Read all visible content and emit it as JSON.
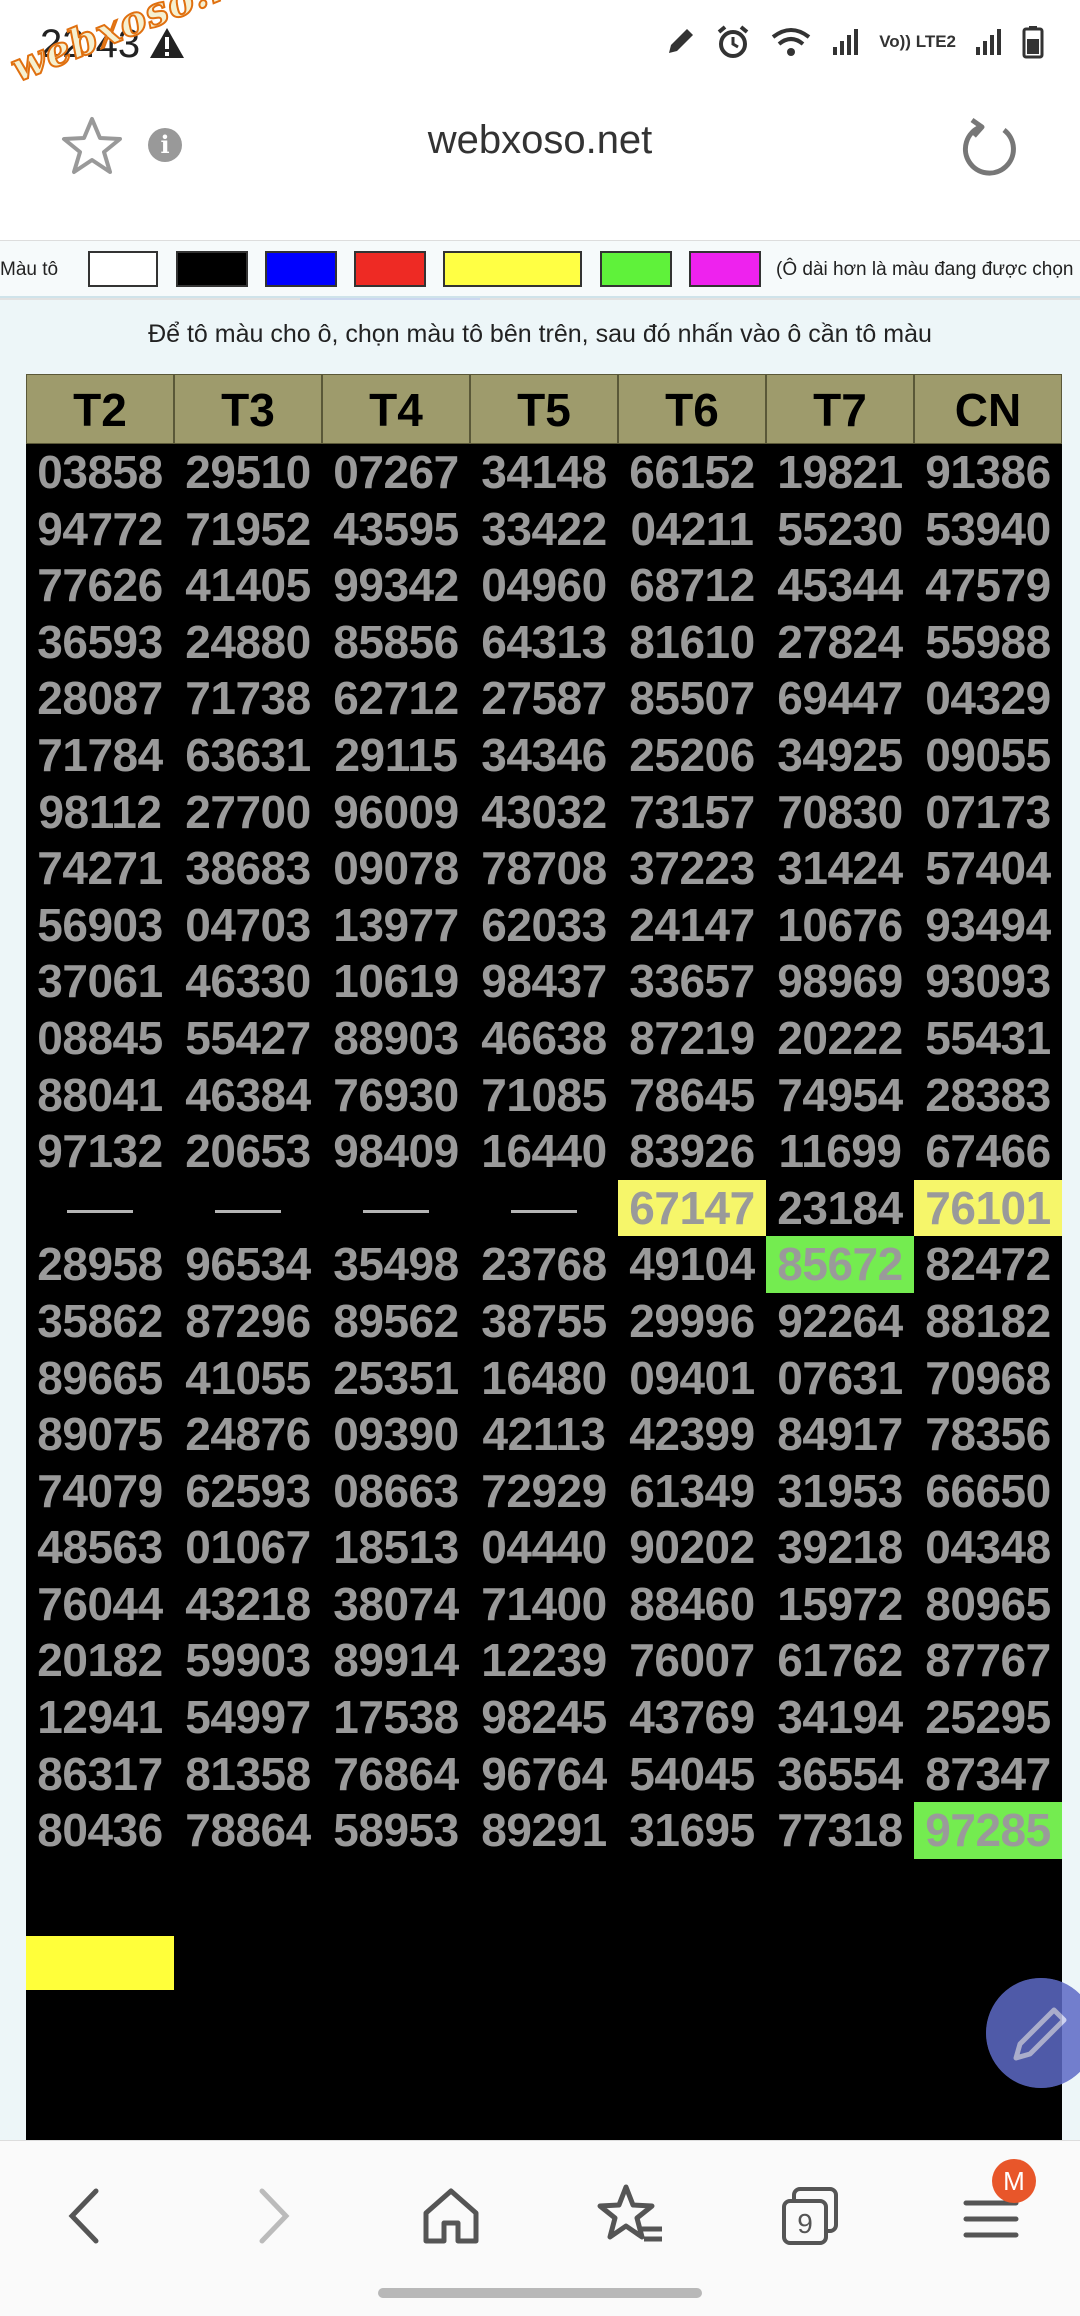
{
  "status": {
    "time": "22:43",
    "watermark": "webxoso.net",
    "network": "Vo)) LTE2"
  },
  "browser": {
    "url": "webxoso.net",
    "info_glyph": "i",
    "tabs_count": "9",
    "badge": "M"
  },
  "colors": {
    "label": "Màu tô",
    "swatches": [
      "#ffffff",
      "#000000",
      "#0000ff",
      "#ee2a24",
      "#ffff44",
      "#5ff23a",
      "#ee22ee"
    ],
    "note": "(Ô dài hơn là màu đang được chọn"
  },
  "instruction": "Để tô màu cho ô, chọn màu tô bên trên, sau đó nhấn vào ô cần tô màu",
  "table": {
    "headers": [
      "T2",
      "T3",
      "T4",
      "T5",
      "T6",
      "T7",
      "CN"
    ],
    "rows": [
      [
        "03858",
        "29510",
        "07267",
        "34148",
        "66152",
        "19821",
        "91386"
      ],
      [
        "94772",
        "71952",
        "43595",
        "33422",
        "04211",
        "55230",
        "53940"
      ],
      [
        "77626",
        "41405",
        "99342",
        "04960",
        "68712",
        "45344",
        "47579"
      ],
      [
        "36593",
        "24880",
        "85856",
        "64313",
        "81610",
        "27824",
        "55988"
      ],
      [
        "28087",
        "71738",
        "62712",
        "27587",
        "85507",
        "69447",
        "04329"
      ],
      [
        "71784",
        "63631",
        "29115",
        "34346",
        "25206",
        "34925",
        "09055"
      ],
      [
        "98112",
        "27700",
        "96009",
        "43032",
        "73157",
        "70830",
        "07173"
      ],
      [
        "74271",
        "38683",
        "09078",
        "78708",
        "37223",
        "31424",
        "57404"
      ],
      [
        "56903",
        "04703",
        "13977",
        "62033",
        "24147",
        "10676",
        "93494"
      ],
      [
        "37061",
        "46330",
        "10619",
        "98437",
        "33657",
        "98969",
        "93093"
      ],
      [
        "08845",
        "55427",
        "88903",
        "46638",
        "87219",
        "20222",
        "55431"
      ],
      [
        "88041",
        "46384",
        "76930",
        "71085",
        "78645",
        "74954",
        "28383"
      ],
      [
        "97132",
        "20653",
        "98409",
        "16440",
        "83926",
        "11699",
        "67466"
      ],
      [
        "",
        "",
        "",
        "",
        "67147",
        "23184",
        "76101"
      ],
      [
        "28958",
        "96534",
        "35498",
        "23768",
        "49104",
        "85672",
        "82472"
      ],
      [
        "35862",
        "87296",
        "89562",
        "38755",
        "29996",
        "92264",
        "88182"
      ],
      [
        "89665",
        "41055",
        "25351",
        "16480",
        "09401",
        "07631",
        "70968"
      ],
      [
        "89075",
        "24876",
        "09390",
        "42113",
        "42399",
        "84917",
        "78356"
      ],
      [
        "74079",
        "62593",
        "08663",
        "72929",
        "61349",
        "31953",
        "66650"
      ],
      [
        "48563",
        "01067",
        "18513",
        "04440",
        "90202",
        "39218",
        "04348"
      ],
      [
        "76044",
        "43218",
        "38074",
        "71400",
        "88460",
        "15972",
        "80965"
      ],
      [
        "20182",
        "59903",
        "89914",
        "12239",
        "76007",
        "61762",
        "87767"
      ],
      [
        "12941",
        "54997",
        "17538",
        "98245",
        "43769",
        "34194",
        "25295"
      ],
      [
        "86317",
        "81358",
        "76864",
        "96764",
        "54045",
        "36554",
        "87347"
      ],
      [
        "80436",
        "78864",
        "58953",
        "89291",
        "31695",
        "77318",
        "97285"
      ]
    ],
    "highlights": [
      {
        "row": 13,
        "col": 4,
        "color": "yellow"
      },
      {
        "row": 13,
        "col": 6,
        "color": "yellow"
      },
      {
        "row": 14,
        "col": 5,
        "color": "green"
      },
      {
        "row": 24,
        "col": 6,
        "color": "green"
      }
    ]
  }
}
